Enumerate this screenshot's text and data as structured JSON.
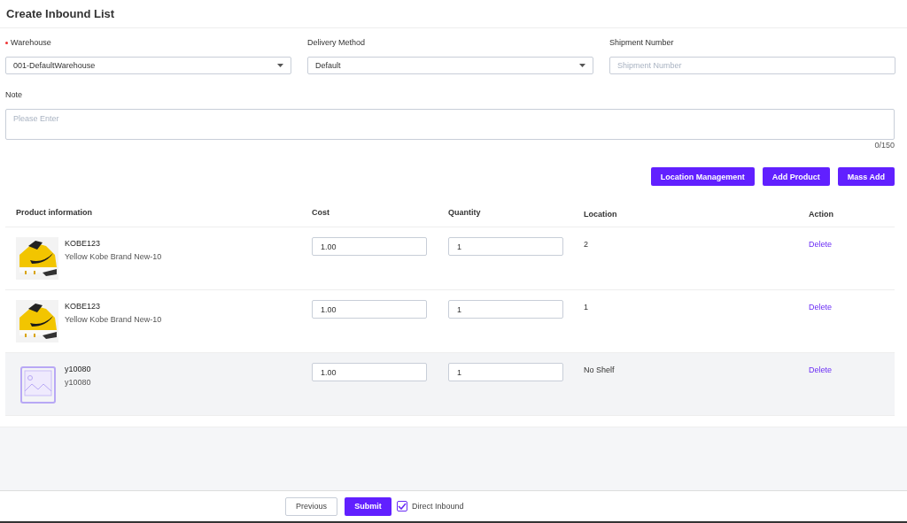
{
  "title": "Create Inbound List",
  "form": {
    "warehouse": {
      "label": "Warehouse",
      "required": true,
      "value": "001-DefaultWarehouse"
    },
    "delivery_method": {
      "label": "Delivery Method",
      "value": "Default"
    },
    "shipment_number": {
      "label": "Shipment Number",
      "placeholder": "Shipment Number"
    },
    "note": {
      "label": "Note",
      "placeholder": "Please Enter",
      "counter": "0/150"
    }
  },
  "actions": [
    "Location Management",
    "Add Product",
    "Mass Add"
  ],
  "table": {
    "columns": [
      "Product information",
      "Cost",
      "Quantity",
      "Location",
      "Action"
    ],
    "rows": [
      {
        "sku": "KOBE123",
        "name": "Yellow Kobe Brand New-10",
        "cost": "1.00",
        "quantity": "1",
        "location": "2",
        "action": "Delete",
        "selected": false
      },
      {
        "sku": "KOBE123",
        "name": "Yellow Kobe Brand New-10",
        "cost": "1.00",
        "quantity": "1",
        "location": "1",
        "action": "Delete",
        "selected": false
      },
      {
        "kind": "placeholder",
        "sku": "y10080",
        "name": "y10080",
        "cost": "1.00",
        "quantity": "1",
        "location": "No Shelf",
        "action": "Delete",
        "selected": true
      }
    ]
  },
  "footer": {
    "previous": "Previous",
    "submit": "Submit",
    "direct_inbound": {
      "label": "Direct Inbound",
      "checked": true
    }
  }
}
